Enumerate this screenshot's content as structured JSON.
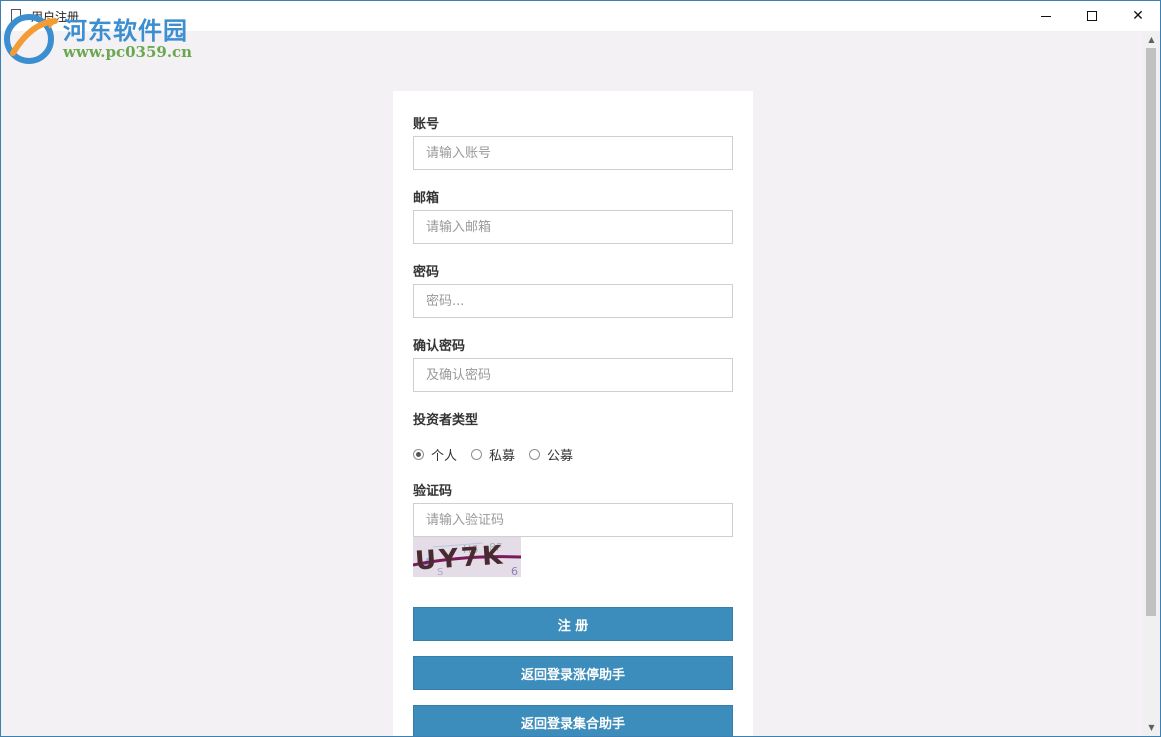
{
  "window": {
    "title": "用户注册"
  },
  "watermark": {
    "title": "河东软件园",
    "url": "www.pc0359.cn"
  },
  "form": {
    "account": {
      "label": "账号",
      "placeholder": "请输入账号",
      "value": ""
    },
    "email": {
      "label": "邮箱",
      "placeholder": "请输入邮箱",
      "value": ""
    },
    "password": {
      "label": "密码",
      "placeholder": "密码...",
      "value": ""
    },
    "confirm": {
      "label": "确认密码",
      "placeholder": "及确认密码",
      "value": ""
    },
    "investor_type": {
      "label": "投资者类型",
      "options": [
        {
          "label": "个人",
          "checked": true
        },
        {
          "label": "私募",
          "checked": false
        },
        {
          "label": "公募",
          "checked": false
        }
      ]
    },
    "captcha": {
      "label": "验证码",
      "placeholder": "请输入验证码",
      "value": "",
      "image_text": "UY7K"
    },
    "register_button": "注 册",
    "back_zhangting_button": "返回登录涨停助手",
    "back_jihe_button": "返回登录集合助手"
  },
  "colors": {
    "primary": "#3c8dbc",
    "background": "#f4f1f5",
    "border": "#3c7fb1"
  }
}
